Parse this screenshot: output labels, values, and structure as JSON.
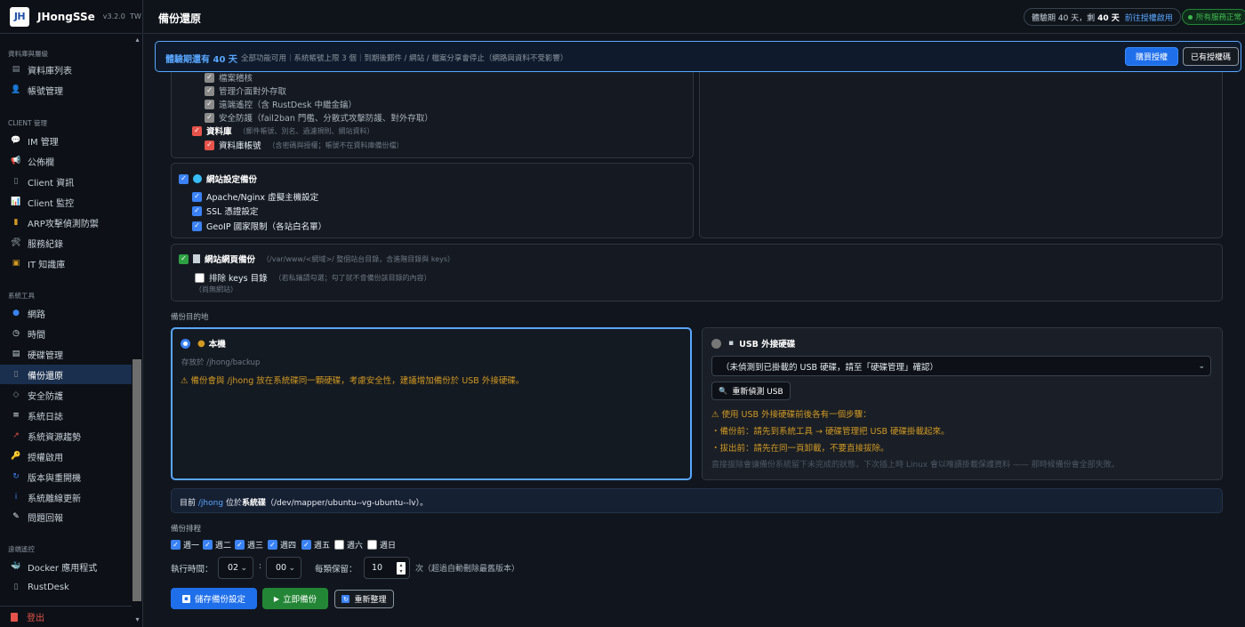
{
  "brand": {
    "logo": "JH",
    "name": "JHongSSe",
    "version": "v3.2.0",
    "locale": "TW"
  },
  "sidebar": {
    "sections": [
      {
        "title": "資料庫與層級",
        "items": [
          {
            "label": "資料庫列表",
            "icon": "database-icon",
            "glyph": "▤",
            "color": "#8b949e"
          },
          {
            "label": "帳號管理",
            "icon": "user-icon",
            "glyph": "👤",
            "color": "#c9d1d9"
          }
        ]
      },
      {
        "title": "CLIENT 管理",
        "items": [
          {
            "label": "IM 管理",
            "icon": "chat-icon",
            "glyph": "💬",
            "color": "#c9d1d9"
          },
          {
            "label": "公佈欄",
            "icon": "megaphone-icon",
            "glyph": "📢",
            "color": "#e5534b"
          },
          {
            "label": "Client 資訊",
            "icon": "document-icon",
            "glyph": "▯",
            "color": "#8b949e"
          },
          {
            "label": "Client 監控",
            "icon": "chart-icon",
            "glyph": "📊",
            "color": "#3b82f6"
          },
          {
            "label": "ARP攻擊偵測防禦",
            "icon": "ladder-icon",
            "glyph": "▮",
            "color": "#d29922"
          },
          {
            "label": "服務紀錄",
            "icon": "tools-icon",
            "glyph": "🛠",
            "color": "#c9d1d9"
          },
          {
            "label": "IT 知識庫",
            "icon": "book-icon",
            "glyph": "▣",
            "color": "#d29922"
          }
        ]
      },
      {
        "title": "系統工具",
        "items": [
          {
            "label": "網路",
            "icon": "globe-icon",
            "glyph": "●",
            "color": "#3b82f6"
          },
          {
            "label": "時間",
            "icon": "clock-icon",
            "glyph": "◷",
            "color": "#e6edf3"
          },
          {
            "label": "硬碟管理",
            "icon": "drive-icon",
            "glyph": "▤",
            "color": "#c9d1d9"
          },
          {
            "label": "備份還原",
            "icon": "backup-icon",
            "glyph": "▯",
            "color": "#8b949e",
            "active": true
          },
          {
            "label": "安全防護",
            "icon": "shield-icon",
            "glyph": "◇",
            "color": "#8b949e"
          },
          {
            "label": "系統日誌",
            "icon": "log-icon",
            "glyph": "≡",
            "color": "#e6edf3"
          },
          {
            "label": "系統資源趨勢",
            "icon": "trend-icon",
            "glyph": "↗",
            "color": "#e5534b"
          },
          {
            "label": "授權啟用",
            "icon": "key-icon",
            "glyph": "🔑",
            "color": "#d29922"
          },
          {
            "label": "版本與重開機",
            "icon": "refresh-icon",
            "glyph": "↻",
            "color": "#3b82f6"
          },
          {
            "label": "系統離線更新",
            "icon": "info-icon",
            "glyph": "i",
            "color": "#3b82f6"
          },
          {
            "label": "問題回報",
            "icon": "memo-icon",
            "glyph": "✎",
            "color": "#e6edf3"
          }
        ]
      },
      {
        "title": "遠端遙控",
        "items": [
          {
            "label": "Docker 應用程式",
            "icon": "docker-icon",
            "glyph": "🐳",
            "color": "#3b82f6"
          },
          {
            "label": "RustDesk",
            "icon": "monitor-icon",
            "glyph": "▯",
            "color": "#8b949e"
          }
        ]
      }
    ],
    "logout": "登出"
  },
  "header": {
    "title": "備份還原",
    "trial_prefix": "體驗期 40 天，剩",
    "trial_days": "40 天",
    "trial_link": "前往授權啟用",
    "service_status": "所有服務正常"
  },
  "banner": {
    "title": "體驗期還有 40 天",
    "text": "全部功能可用｜系統帳號上限 3 個｜到期後郵件 / 網站 / 檔案分享會停止（網路與資料不受影響）",
    "buy_label": "購買授權",
    "have_label": "已有授權碼"
  },
  "system_items": [
    {
      "label": "檔案稽核",
      "checked": true
    },
    {
      "label": "管理介面對外存取",
      "checked": true
    },
    {
      "label": "遠端遙控（含 RustDesk 中繼金鑰）",
      "checked": true
    },
    {
      "label": "安全防護（fail2ban 門檻、分散式攻擊防護、對外存取）",
      "checked": true
    }
  ],
  "database": {
    "label": "資料庫",
    "hint": "（郵件帳號、別名、過濾規則、網站資料）",
    "sub_label": "資料庫帳號",
    "sub_hint": "（含密碼與授權；帳號不在資料庫備份檔）"
  },
  "web_config": {
    "label": "網站設定備份",
    "items": [
      "Apache/Nginx 虛擬主機設定",
      "SSL 憑證設定",
      "GeoIP 國家限制（各站白名單）"
    ]
  },
  "web_files": {
    "label": "網站網頁備份",
    "hint": "（/var/www/<網域>/ 整個站台目錄，含進階目錄與 keys）",
    "exclude_label": "排除 keys 目錄",
    "exclude_hint": "（若私鑰請勾選；勾了就不會備份該目錄的內容）",
    "no_sites": "（尚無網站）"
  },
  "destination": {
    "section_label": "備份目的地",
    "local": {
      "label": "本機",
      "path_placeholder": "存放於 /jhong/backup",
      "warning": "⚠ 備份會與 /jhong 放在系統碟同一顆硬碟，考慮安全性，建議增加備份於 USB 外接硬碟。"
    },
    "usb": {
      "label": "USB 外接硬碟",
      "select_value": "（未偵測到已掛載的 USB 硬碟，請至「硬碟管理」確認）",
      "rescan_label": "重新偵測 USB",
      "notice_title": "⚠ 使用 USB 外接硬碟前後各有一個步驟：",
      "step1": "・備份前：請先到系統工具 → 硬碟管理把 USB 硬碟掛載起來。",
      "step2": "・拔出前：請先在同一頁卸載，不要直接拔除。",
      "footnote": "直接拔除會讓備份系統留下未完成的狀態，下次插上時 Linux 會以唯讀掛載保護資料 —— 那時候備份會全部失敗。"
    }
  },
  "disk_info": {
    "prefix": "目前",
    "path": "/jhong",
    "mid": "位於",
    "tag": "系統碟",
    "device": "（/dev/mapper/ubuntu--vg-ubuntu--lv）。"
  },
  "schedule": {
    "section_label": "備份排程",
    "days": [
      {
        "label": "週一",
        "checked": true
      },
      {
        "label": "週二",
        "checked": true
      },
      {
        "label": "週三",
        "checked": true
      },
      {
        "label": "週四",
        "checked": true
      },
      {
        "label": "週五",
        "checked": true
      },
      {
        "label": "週六",
        "checked": false
      },
      {
        "label": "週日",
        "checked": false
      }
    ],
    "time_label": "執行時間：",
    "hour": "02",
    "minute": "00",
    "keep_label": "每類保留：",
    "keep_value": "10",
    "keep_suffix": "次（超過自動刪除最舊版本）"
  },
  "actions": {
    "save": "儲存備份設定",
    "run": "立即備份",
    "reset": "重新整理"
  },
  "colors": {
    "accent": "#3b82f6",
    "warning": "#d29922",
    "success": "#2ea043",
    "danger": "#e5534b"
  }
}
